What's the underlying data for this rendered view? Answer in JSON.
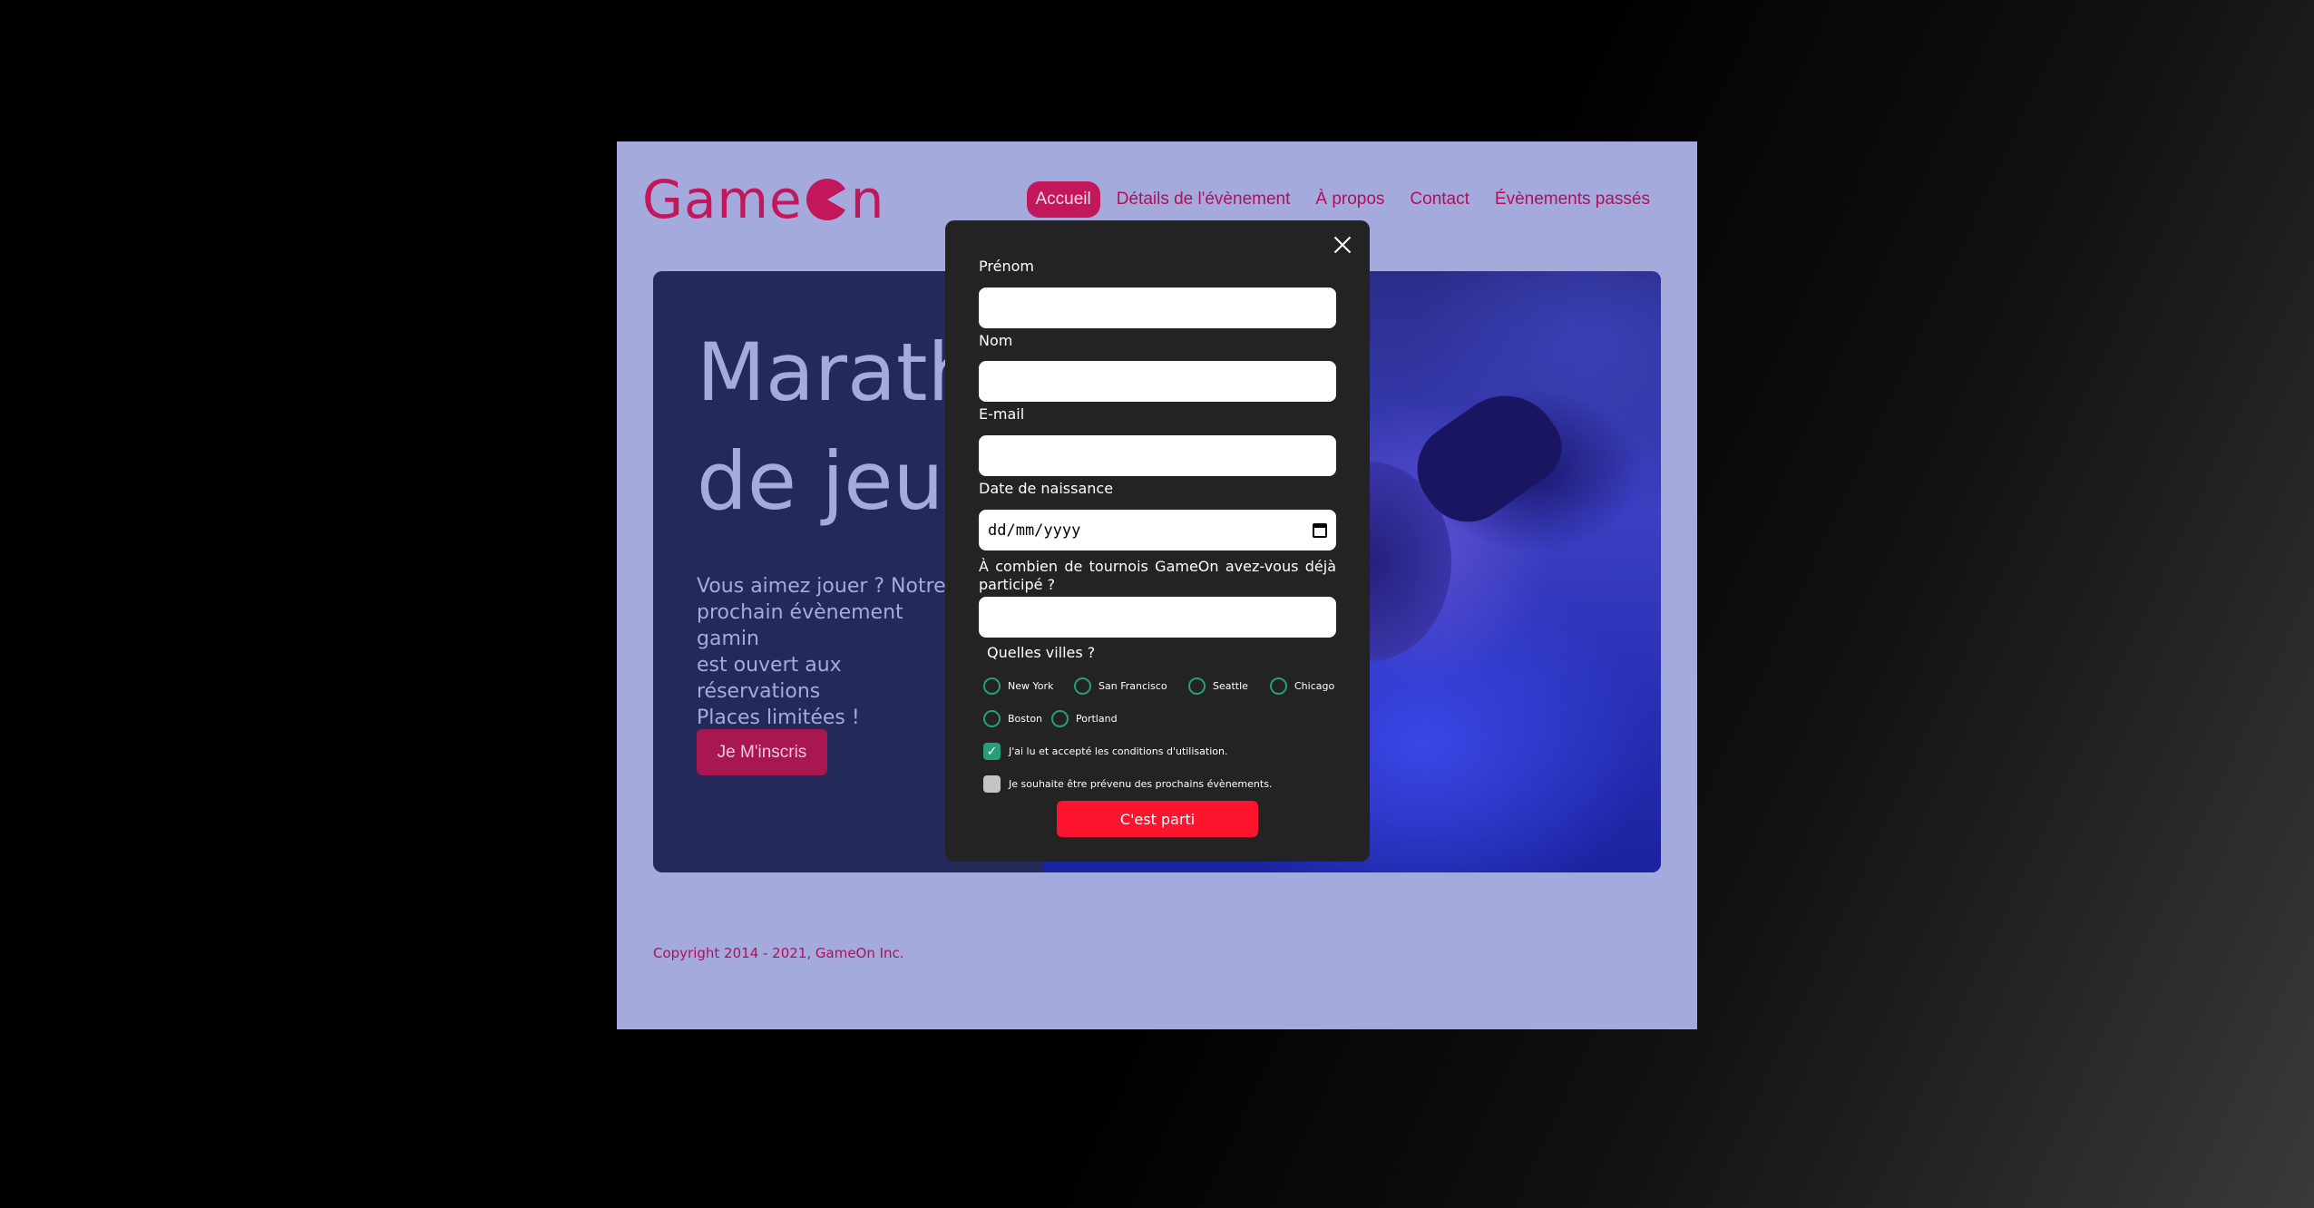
{
  "header": {
    "logo_left": "Game",
    "logo_right": "n",
    "nav": [
      {
        "label": "Accueil",
        "active": true
      },
      {
        "label": "Détails de l'évènement",
        "active": false
      },
      {
        "label": "À propos",
        "active": false
      },
      {
        "label": "Contact",
        "active": false
      },
      {
        "label": "Évènements passés",
        "active": false
      }
    ]
  },
  "hero": {
    "title": "Marath\nde jeux",
    "text": "Vous aimez jouer ? Notre\nprochain évènement gamin\nest ouvert aux réservations\nPlaces limitées !",
    "button": "Je M'inscris"
  },
  "footer": {
    "copyright": "Copyright 2014 - 2021, GameOn Inc."
  },
  "modal": {
    "fields": {
      "first_name": "Prénom",
      "last_name": "Nom",
      "email": "E-mail",
      "birthdate": "Date de naissance",
      "birthdate_placeholder": "dd/mm/yyyy",
      "tournaments": "À combien de tournois GameOn avez-vous déjà participé ?"
    },
    "cities_title": "Quelles villes ?",
    "cities": [
      "New York",
      "San Francisco",
      "Seattle",
      "Chicago",
      "Boston",
      "Portland"
    ],
    "checkbox_terms": "J'ai lu et accepté les conditions d'utilisation.",
    "checkbox_terms_checked": true,
    "checkbox_news": "Je souhaite être prévenu des prochains évènements.",
    "checkbox_news_checked": false,
    "submit": "C'est parti"
  },
  "colors": {
    "brand": "#c2185b",
    "page_bg": "#a4aadb",
    "modal_bg": "#232323",
    "submit": "#fe142f",
    "radio": "#279e7a"
  }
}
